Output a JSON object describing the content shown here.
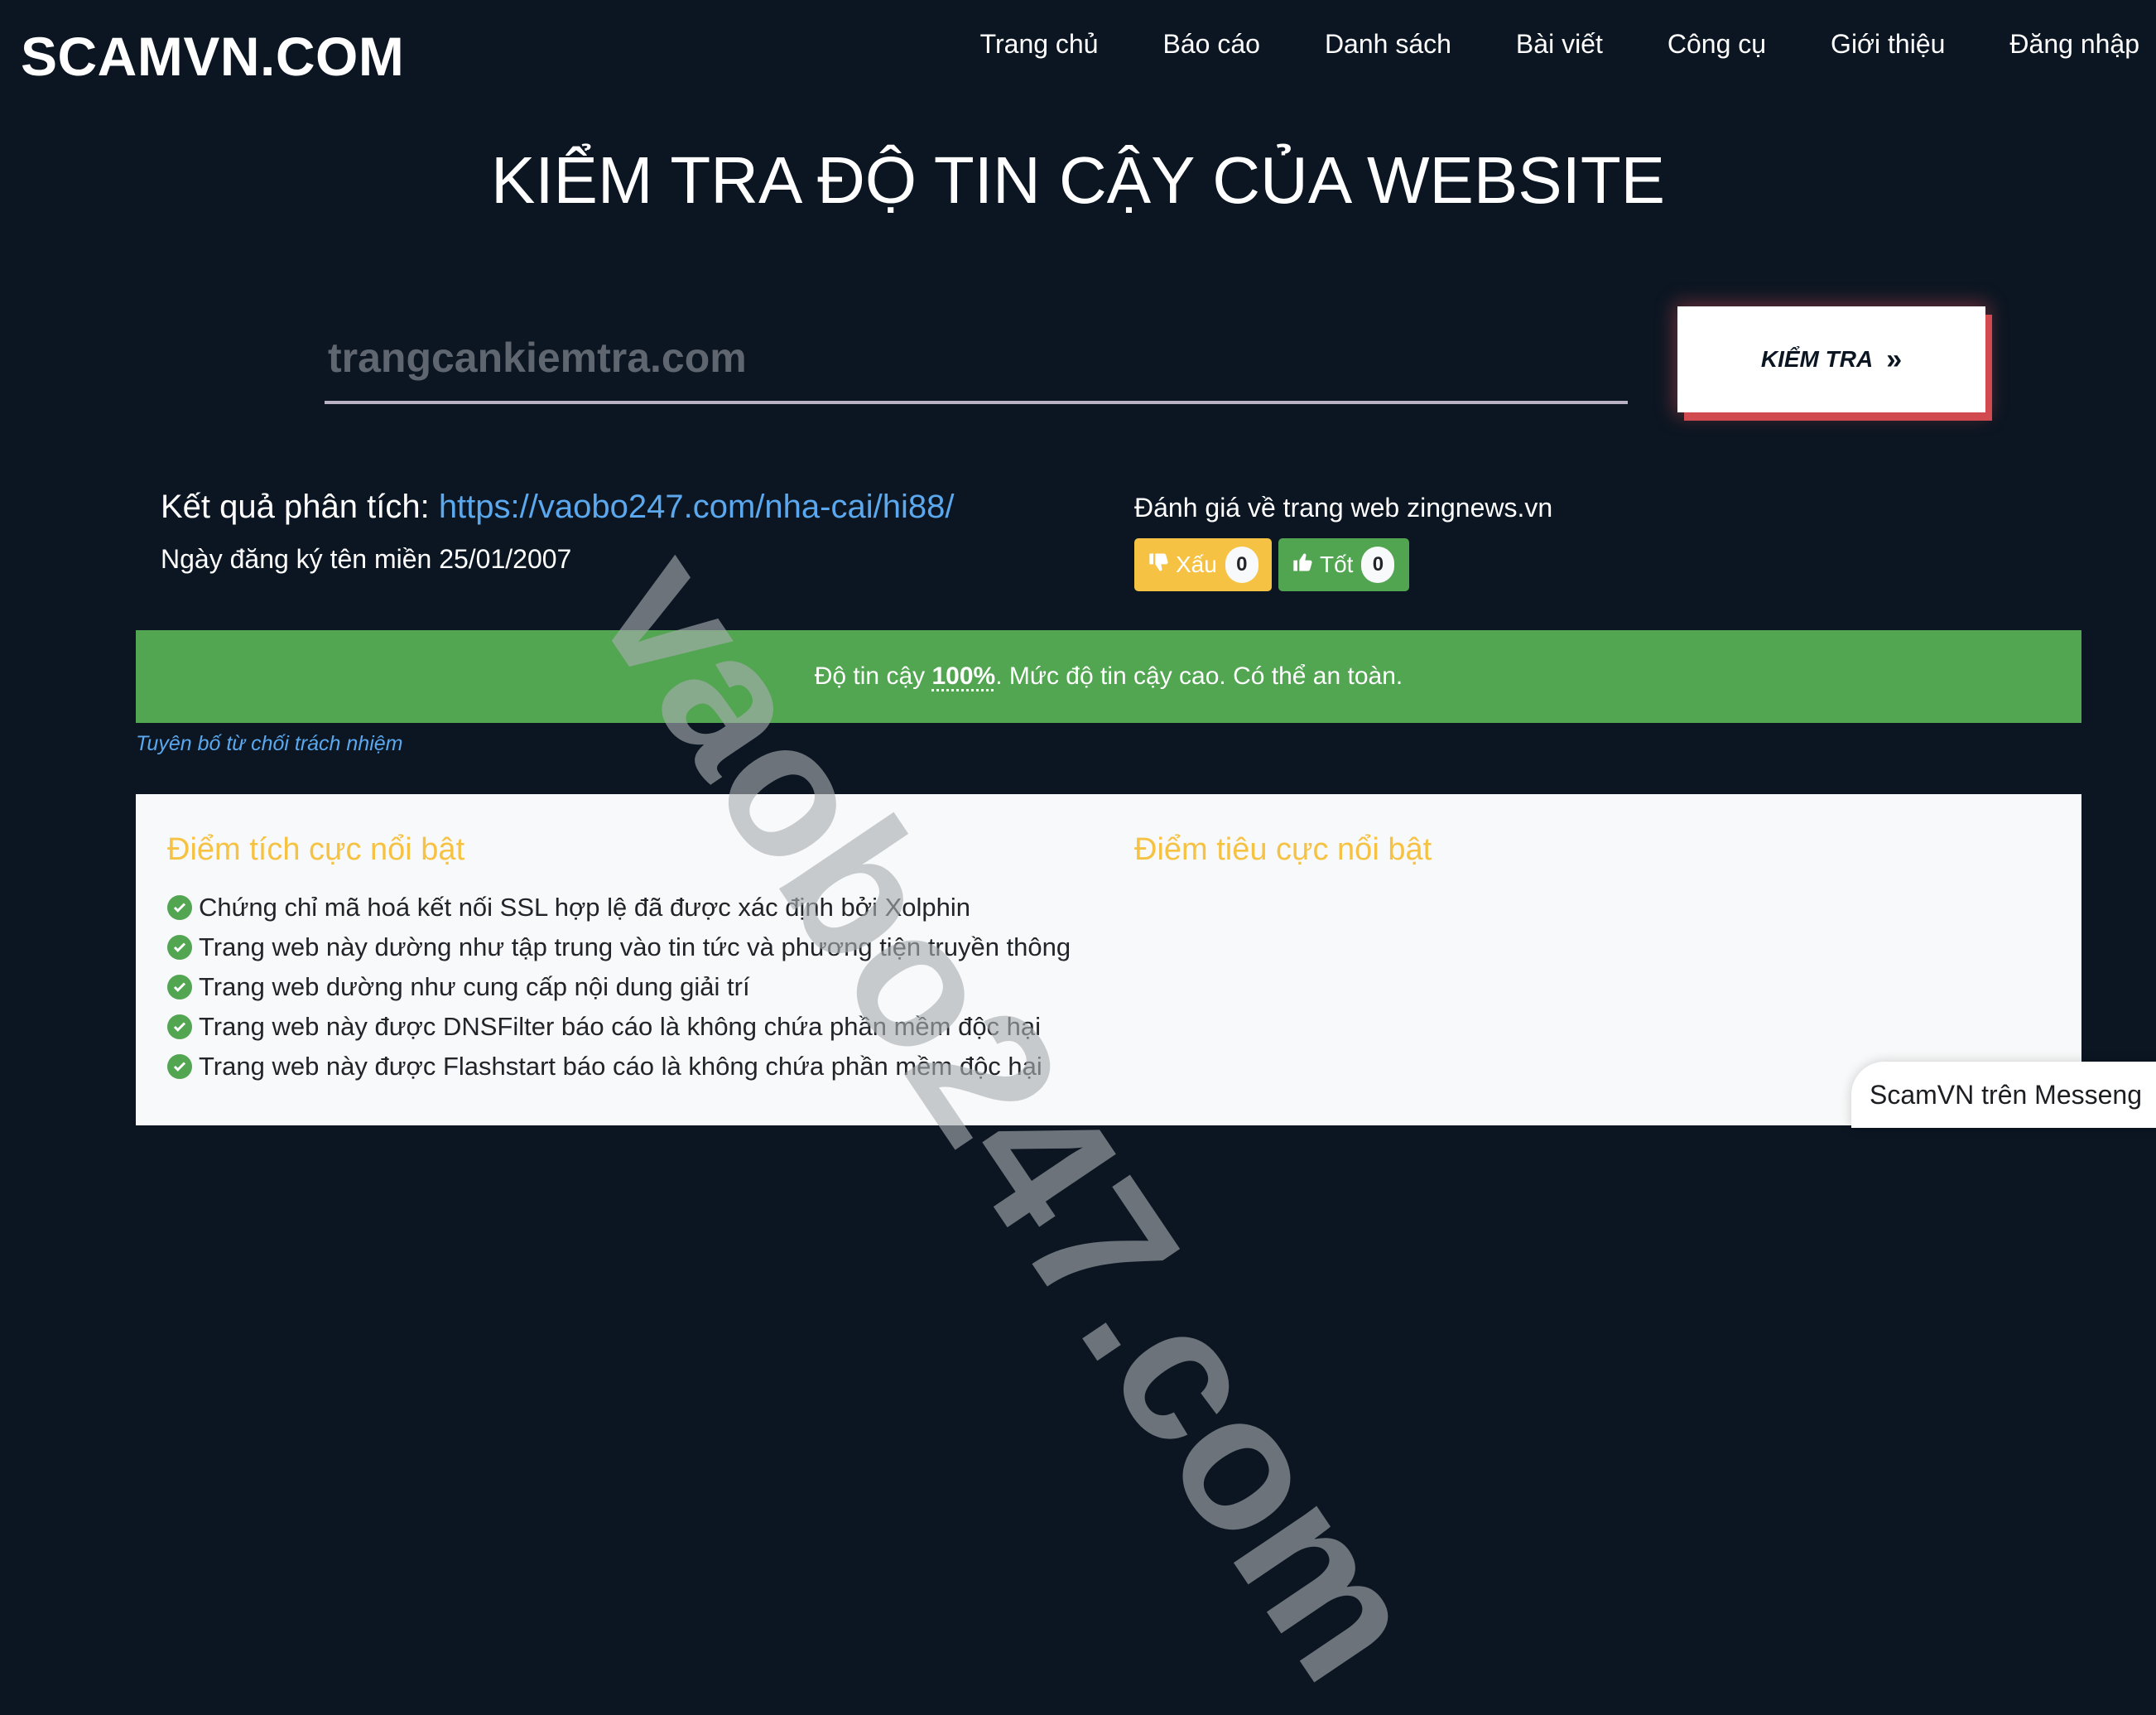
{
  "header": {
    "logo": "SCAMVN.COM",
    "nav": [
      {
        "label": "Trang chủ"
      },
      {
        "label": "Báo cáo"
      },
      {
        "label": "Danh sách"
      },
      {
        "label": "Bài viết"
      },
      {
        "label": "Công cụ"
      },
      {
        "label": "Giới thiệu"
      },
      {
        "label": "Đăng nhập"
      }
    ]
  },
  "main": {
    "title": "KIỂM TRA ĐỘ TIN CẬY CỦA WEBSITE",
    "search": {
      "placeholder": "trangcankiemtra.com",
      "value": "",
      "button_label": "KIỂM TRA",
      "button_icon": "double-chevron-right-icon"
    },
    "result": {
      "label": "Kết quả phân tích:",
      "url": "https://vaobo247.com/nha-cai/hi88/",
      "registration_date": "Ngày đăng ký tên miền 25/01/2007"
    },
    "rating": {
      "title": "Đánh giá về trang web zingnews.vn",
      "bad": {
        "label": "Xấu",
        "count": "0",
        "icon": "thumbs-down-icon",
        "color": "#f6c244"
      },
      "good": {
        "label": "Tốt",
        "count": "0",
        "icon": "thumbs-up-icon",
        "color": "#52a551"
      }
    },
    "trust": {
      "prefix": "Độ tin cậy",
      "percent": "100%",
      "suffix": ". Mức độ tin cậy cao. Có thể an toàn.",
      "level": 1.0,
      "color": "#52a551"
    },
    "disclaimer": "Tuyên bố từ chối trách nhiệm",
    "positives": {
      "title": "Điểm tích cực nổi bật",
      "items": [
        "Chứng chỉ mã hoá kết nối SSL hợp lệ đã được xác định bởi Xolphin",
        "Trang web này dường như tập trung vào tin tức và phương tiện truyền thông",
        "Trang web dường như cung cấp nội dung giải trí",
        "Trang web này được DNSFilter báo cáo là không chứa phần mềm độc hại",
        "Trang web này được Flashstart báo cáo là không chứa phần mềm độc hại"
      ]
    },
    "negatives": {
      "title": "Điểm tiêu cực nổi bật",
      "items": []
    }
  },
  "overlay": {
    "watermark": "vaobo247.com",
    "messenger_label": "ScamVN trên Messeng"
  },
  "colors": {
    "background": "#0b1622",
    "accent_yellow": "#f6c244",
    "link_blue": "#5ba8ee",
    "button_shadow_red": "#d14a50"
  }
}
